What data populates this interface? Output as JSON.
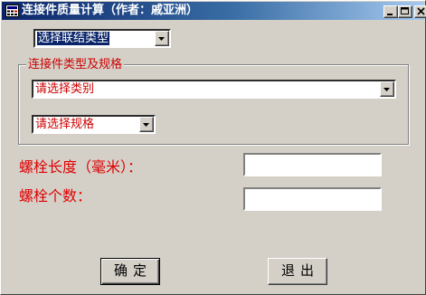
{
  "window": {
    "title": "连接件质量计算（作者：戚亚洲）"
  },
  "connection_combo": {
    "value": "选择联结类型"
  },
  "group": {
    "caption": "连接件类型及规格",
    "category_combo": {
      "value": "请选择类别"
    },
    "spec_combo": {
      "value": "请选择规格"
    }
  },
  "fields": {
    "bolt_length_label": "螺栓长度（毫米）：",
    "bolt_length_value": "",
    "bolt_count_label": "螺栓个数：",
    "bolt_count_value": ""
  },
  "buttons": {
    "ok_label": "确定",
    "exit_label": "退出"
  },
  "icons": {
    "app": "calculator-app-icon",
    "minimize": "minimize-icon",
    "maximize": "maximize-icon",
    "close": "close-icon",
    "dropdown": "chevron-down-icon"
  },
  "colors": {
    "title_bar": "#0a246a",
    "label_red": "#e00000",
    "selection": "#0a246a",
    "face": "#d4d0c8"
  }
}
